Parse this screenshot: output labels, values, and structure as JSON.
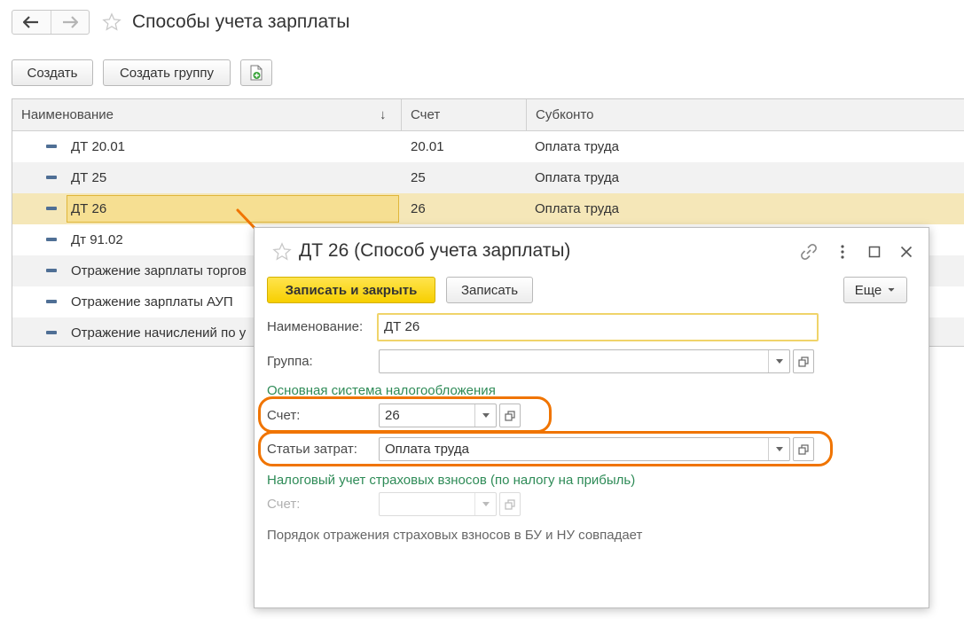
{
  "page": {
    "title": "Способы учета зарплаты"
  },
  "toolbar": {
    "create_label": "Создать",
    "create_group_label": "Создать группу"
  },
  "table": {
    "columns": [
      "Наименование",
      "Счет",
      "Субконто"
    ],
    "sort_indicator": "↓",
    "rows": [
      {
        "name": "ДТ 20.01",
        "account": "20.01",
        "subconto": "Оплата труда"
      },
      {
        "name": "ДТ 25",
        "account": "25",
        "subconto": "Оплата труда"
      },
      {
        "name": "ДТ 26",
        "account": "26",
        "subconto": "Оплата труда"
      },
      {
        "name": "Дт 91.02",
        "account": "",
        "subconto": ""
      },
      {
        "name": "Отражение зарплаты торгов",
        "account": "",
        "subconto": ""
      },
      {
        "name": "Отражение зарплаты АУП",
        "account": "",
        "subconto": ""
      },
      {
        "name": "Отражение начислений по у",
        "account": "",
        "subconto": ""
      }
    ]
  },
  "dialog": {
    "title": "ДТ 26 (Способ учета зарплаты)",
    "save_close_label": "Записать и закрыть",
    "save_label": "Записать",
    "more_label": "Еще",
    "name_label": "Наименование:",
    "name_value": "ДТ 26",
    "group_label": "Группа:",
    "group_value": "",
    "section1": "Основная система налогообложения",
    "account_label": "Счет:",
    "account_value": "26",
    "cost_label": "Статьи затрат:",
    "cost_value": "Оплата труда",
    "section2": "Налоговый учет страховых взносов (по налогу на прибыль)",
    "tax_account_label": "Счет:",
    "tax_account_value": "",
    "note": "Порядок отражения страховых взносов в БУ и НУ совпадает"
  },
  "colors": {
    "highlight": "#f07400",
    "primary_button": "#f7cf00",
    "section_text": "#2e8b57",
    "selected_row": "#f5e7b8"
  }
}
